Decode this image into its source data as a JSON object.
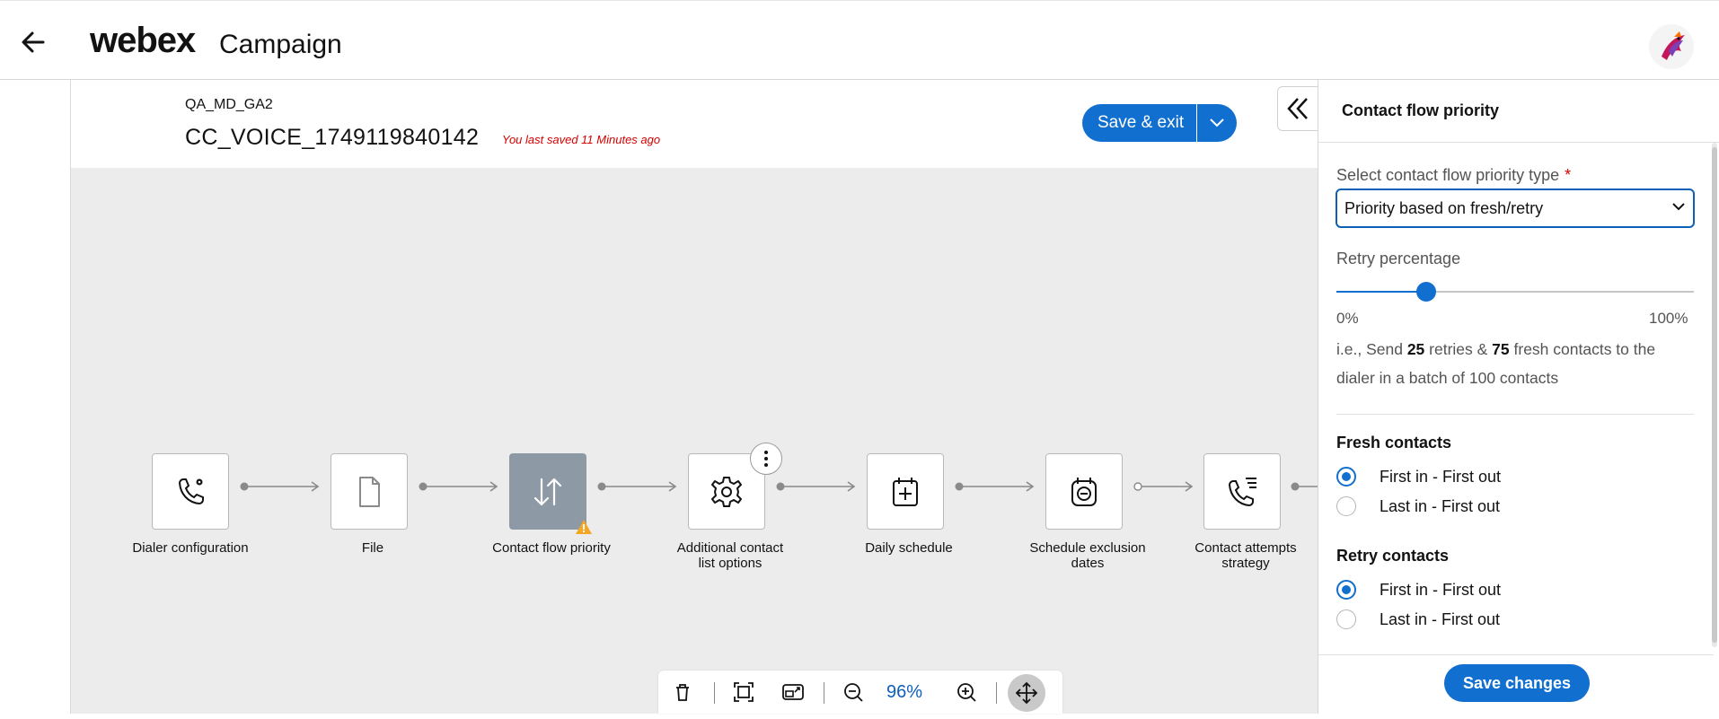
{
  "app": {
    "logo": "webex",
    "title": "Campaign"
  },
  "campaign": {
    "subtitle": "QA_MD_GA2",
    "name": "CC_VOICE_1749119840142",
    "saved_status": "You last saved 11 Minutes ago",
    "save_exit_label": "Save & exit"
  },
  "flow": {
    "nodes": [
      {
        "label": "Dialer configuration",
        "icon": "phone-settings-icon"
      },
      {
        "label": "File",
        "icon": "file-icon"
      },
      {
        "label": "Contact flow priority",
        "icon": "arrows-up-down-icon",
        "active": true,
        "warning": true
      },
      {
        "label": "Additional contact list options",
        "icon": "gear-icon"
      },
      {
        "label": "Daily schedule",
        "icon": "calendar-add-icon"
      },
      {
        "label": "Schedule exclusion dates",
        "icon": "calendar-minus-icon"
      },
      {
        "label": "Contact attempts strategy",
        "icon": "phone-list-icon"
      }
    ]
  },
  "toolbar": {
    "zoom": "96%"
  },
  "panel": {
    "title": "Contact flow priority",
    "select_label": "Select contact flow priority type",
    "select_required": "*",
    "select_value": "Priority based on fresh/retry",
    "retry_label": "Retry percentage",
    "retry_percent": 25,
    "slider_min": "0%",
    "slider_max": "100%",
    "explain": {
      "p1": "i.e., Send ",
      "retries": "25",
      "p2": " retries & ",
      "fresh": "75",
      "p3": " fresh contacts to the dialer in a batch of 100 contacts"
    },
    "fresh": {
      "title": "Fresh contacts",
      "options": [
        "First in - First out",
        "Last in - First out"
      ],
      "selected": 0
    },
    "retry": {
      "title": "Retry contacts",
      "options": [
        "First in - First out",
        "Last in - First out"
      ],
      "selected": 0
    },
    "save_label": "Save changes"
  },
  "colors": {
    "accent": "#1170cf",
    "active_node": "#8d99a4",
    "error": "#d40000",
    "warning": "#f5a623"
  }
}
